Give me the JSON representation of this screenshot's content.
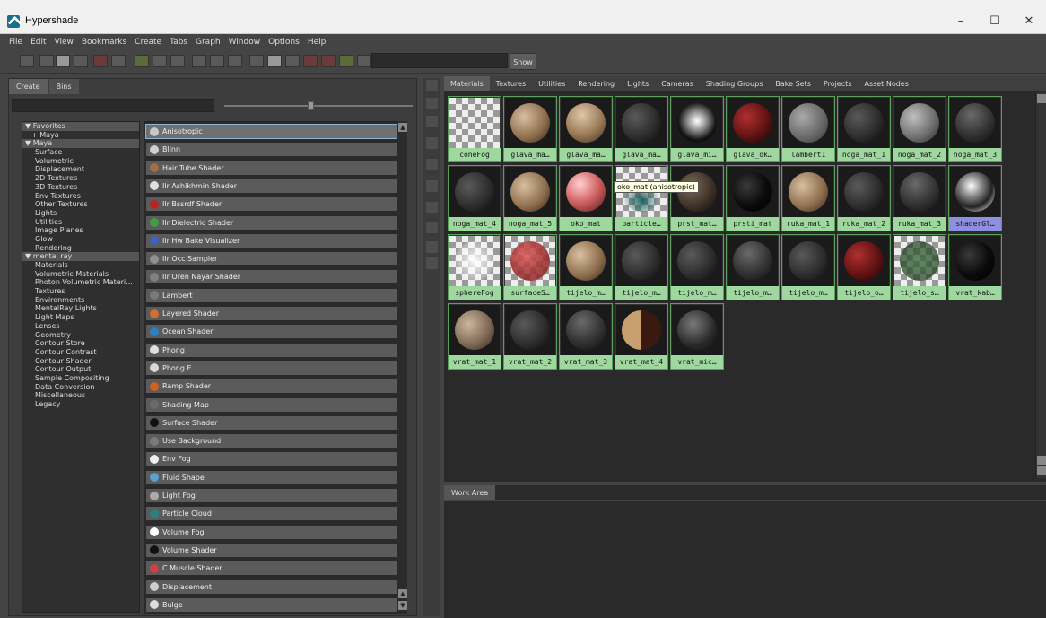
{
  "window": {
    "title": "Hypershade",
    "minimize": "–",
    "maximize": "☐",
    "close": "✕"
  },
  "menu": [
    "File",
    "Edit",
    "View",
    "Bookmarks",
    "Create",
    "Tabs",
    "Graph",
    "Window",
    "Options",
    "Help"
  ],
  "toolbar": {
    "show_label": "Show"
  },
  "left_tabs": [
    "Create",
    "Bins"
  ],
  "tree": [
    {
      "label": "Favorites",
      "type": "hdr",
      "arrow": "▼"
    },
    {
      "label": "+ Maya",
      "type": "plus"
    },
    {
      "label": "Maya",
      "type": "hdr",
      "arrow": "▼"
    },
    {
      "label": "Surface",
      "type": "sub"
    },
    {
      "label": "Volumetric",
      "type": "sub"
    },
    {
      "label": "Displacement",
      "type": "sub"
    },
    {
      "label": "2D Textures",
      "type": "sub"
    },
    {
      "label": "3D Textures",
      "type": "sub"
    },
    {
      "label": "Env Textures",
      "type": "sub"
    },
    {
      "label": "Other Textures",
      "type": "sub"
    },
    {
      "label": "Lights",
      "type": "sub"
    },
    {
      "label": "Utilities",
      "type": "sub"
    },
    {
      "label": "Image Planes",
      "type": "sub"
    },
    {
      "label": "Glow",
      "type": "sub"
    },
    {
      "label": "Rendering",
      "type": "sub"
    },
    {
      "label": "mental ray",
      "type": "hdr",
      "arrow": "▼"
    },
    {
      "label": "Materials",
      "type": "sub"
    },
    {
      "label": "Volumetric Materials",
      "type": "sub"
    },
    {
      "label": "Photon Volumetric Materi...",
      "type": "sub"
    },
    {
      "label": "Textures",
      "type": "sub"
    },
    {
      "label": "Environments",
      "type": "sub"
    },
    {
      "label": "MentalRay Lights",
      "type": "sub"
    },
    {
      "label": "Light Maps",
      "type": "sub"
    },
    {
      "label": "Lenses",
      "type": "sub"
    },
    {
      "label": "Geometry",
      "type": "sub"
    },
    {
      "label": "Contour Store",
      "type": "sub"
    },
    {
      "label": "Contour Contrast",
      "type": "sub"
    },
    {
      "label": "Contour Shader",
      "type": "sub"
    },
    {
      "label": "Contour Output",
      "type": "sub"
    },
    {
      "label": "Sample Compositing",
      "type": "sub"
    },
    {
      "label": "Data Conversion",
      "type": "sub"
    },
    {
      "label": "Miscellaneous",
      "type": "sub"
    },
    {
      "label": "Legacy",
      "type": "sub"
    }
  ],
  "nodes": [
    {
      "label": "Anisotropic",
      "color": "#c8c8c8",
      "selected": true
    },
    {
      "label": "Blinn",
      "color": "#d0d0d0"
    },
    {
      "label": "Hair Tube Shader",
      "color": "#a0704a"
    },
    {
      "label": "Ilr Ashikhmin Shader",
      "color": "#e0e0e0"
    },
    {
      "label": "Ilr Bssrdf Shader",
      "color": "#c02020"
    },
    {
      "label": "Ilr Dielectric Shader",
      "color": "#40a040"
    },
    {
      "label": "Ilr Hw Bake Visualizer",
      "color": "#4060c0"
    },
    {
      "label": "Ilr Occ Sampler",
      "color": "#909090"
    },
    {
      "label": "Ilr Oren Nayar Shader",
      "color": "#808080"
    },
    {
      "label": "Lambert",
      "color": "#7a7a7a"
    },
    {
      "label": "Layered Shader",
      "color": "#d07030"
    },
    {
      "label": "Ocean Shader",
      "color": "#3080c0"
    },
    {
      "label": "Phong",
      "color": "#e0e0e0"
    },
    {
      "label": "Phong E",
      "color": "#d8d8d8"
    },
    {
      "label": "Ramp Shader",
      "color": "#d06020"
    },
    {
      "label": "Shading Map",
      "color": "#6a6a6a"
    },
    {
      "label": "Surface Shader",
      "color": "#111111"
    },
    {
      "label": "Use Background",
      "color": "#7a7a7a"
    },
    {
      "label": "Env Fog",
      "color": "#f0f0f0"
    },
    {
      "label": "Fluid Shape",
      "color": "#5aa0d0"
    },
    {
      "label": "Light Fog",
      "color": "#aaaaaa"
    },
    {
      "label": "Particle Cloud",
      "color": "#2a8080"
    },
    {
      "label": "Volume Fog",
      "color": "#ffffff"
    },
    {
      "label": "Volume Shader",
      "color": "#111111"
    },
    {
      "label": "C Muscle Shader",
      "color": "#d04040"
    },
    {
      "label": "Displacement",
      "color": "#cccccc"
    },
    {
      "label": "Bulge",
      "color": "#dddddd"
    }
  ],
  "right_tabs": [
    "Materials",
    "Textures",
    "Utilities",
    "Rendering",
    "Lights",
    "Cameras",
    "Shading Groups",
    "Bake Sets",
    "Projects",
    "Asset Nodes"
  ],
  "swatches": [
    {
      "label": "coneFog",
      "style": "checker"
    },
    {
      "label": "glava_ma…",
      "style": "skin"
    },
    {
      "label": "glava_ma…",
      "style": "skin2"
    },
    {
      "label": "glava_ma…",
      "style": "dark"
    },
    {
      "label": "glava_mi…",
      "style": "glow"
    },
    {
      "label": "glava_ok…",
      "style": "red"
    },
    {
      "label": "lambert1",
      "style": "grey"
    },
    {
      "label": "noga_mat_1",
      "style": "dark"
    },
    {
      "label": "noga_mat_2",
      "style": "greylight"
    },
    {
      "label": "noga_mat_3",
      "style": "dark2"
    },
    {
      "label": "noga_mat_4",
      "style": "dark"
    },
    {
      "label": "noga_mat_5",
      "style": "skin"
    },
    {
      "label": "oko_mat",
      "style": "pink"
    },
    {
      "label": "particle…",
      "style": "checkerteal"
    },
    {
      "label": "prst_mat…",
      "style": "brown"
    },
    {
      "label": "prsti_mat",
      "style": "black"
    },
    {
      "label": "ruka_mat_1",
      "style": "skin"
    },
    {
      "label": "ruka_mat_2",
      "style": "dark"
    },
    {
      "label": "ruka_mat_3",
      "style": "dark2"
    },
    {
      "label": "shaderGl…",
      "style": "chrome",
      "selected": true
    },
    {
      "label": "sphereFog",
      "style": "checkerwhite"
    },
    {
      "label": "surfaceS…",
      "style": "checkerred"
    },
    {
      "label": "tijelo_m…",
      "style": "skin"
    },
    {
      "label": "tijelo_m…",
      "style": "dark"
    },
    {
      "label": "tijelo_m…",
      "style": "dark"
    },
    {
      "label": "tijelo_m…",
      "style": "dark2"
    },
    {
      "label": "tijelo_m…",
      "style": "dark"
    },
    {
      "label": "tijelo_o…",
      "style": "red"
    },
    {
      "label": "tijelo_s…",
      "style": "checkergreen"
    },
    {
      "label": "vrat_kab…",
      "style": "black"
    },
    {
      "label": "vrat_mat_1",
      "style": "skin3"
    },
    {
      "label": "vrat_mat_2",
      "style": "dark"
    },
    {
      "label": "vrat_mat_3",
      "style": "dark2"
    },
    {
      "label": "vrat_mat_4",
      "style": "split"
    },
    {
      "label": "vrat_mic…",
      "style": "speck"
    }
  ],
  "tooltip": "oko_mat (anisotropic)",
  "work_area": {
    "tab": "Work Area"
  }
}
